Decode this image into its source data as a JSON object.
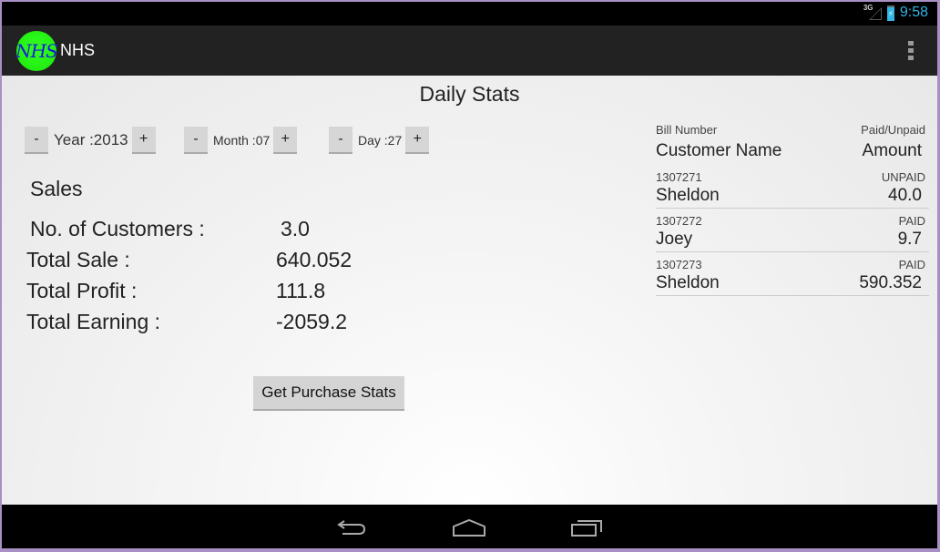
{
  "status_bar": {
    "network": "3G",
    "time": "9:58"
  },
  "action_bar": {
    "logo_text": "NHS",
    "title": "NHS",
    "overflow_icon": "overflow-menu-icon"
  },
  "page": {
    "title": "Daily Stats"
  },
  "date_selector": {
    "year": {
      "minus": "-",
      "label": "Year :2013",
      "plus": "+"
    },
    "month": {
      "minus": "-",
      "label": "Month :07",
      "plus": "+"
    },
    "day": {
      "minus": "-",
      "label": "Day :27",
      "plus": "+"
    }
  },
  "sales": {
    "heading": "Sales",
    "rows": [
      {
        "label": "No. of Customers :",
        "value": "3.0"
      },
      {
        "label": "Total Sale :",
        "value": "640.052"
      },
      {
        "label": "Total Profit :",
        "value": "111.8"
      },
      {
        "label": "Total Earning :",
        "value": "-2059.2"
      }
    ]
  },
  "purchase_button": "Get Purchase Stats",
  "bills": {
    "header": {
      "bill_number": "Bill Number",
      "paid_unpaid": "Paid/Unpaid",
      "customer_name": "Customer Name",
      "amount": "Amount"
    },
    "items": [
      {
        "bill_number": "1307271",
        "status": "UNPAID",
        "customer": "Sheldon",
        "amount": "40.0"
      },
      {
        "bill_number": "1307272",
        "status": "PAID",
        "customer": "Joey",
        "amount": "9.7"
      },
      {
        "bill_number": "1307273",
        "status": "PAID",
        "customer": "Sheldon",
        "amount": "590.352"
      }
    ]
  },
  "nav_bar": {
    "back": "back-icon",
    "home": "home-icon",
    "recents": "recents-icon"
  }
}
